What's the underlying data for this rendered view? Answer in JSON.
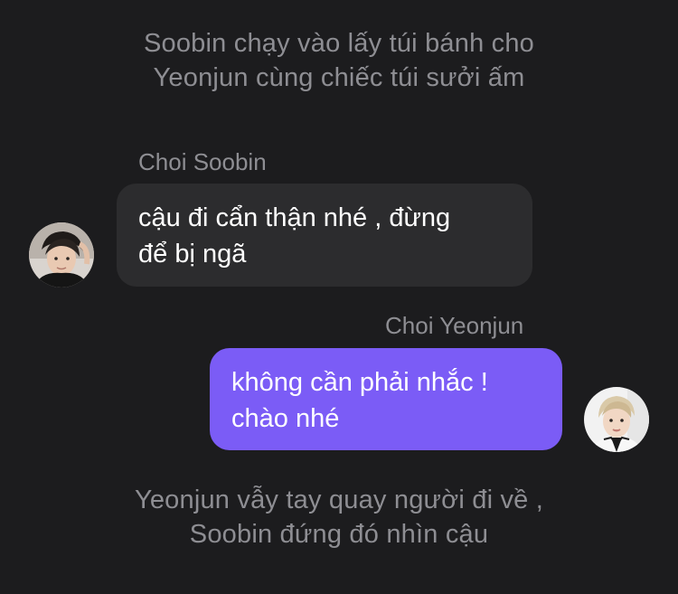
{
  "narration_top": {
    "line1": "Soobin chạy vào lấy túi bánh cho",
    "line2": "Yeonjun cùng chiếc túi sưởi ấm"
  },
  "messages": [
    {
      "sender": "Choi Soobin",
      "lines": [
        "cậu đi cẩn thận nhé , đừng",
        "để bị ngã"
      ],
      "bubble_color": "#2c2c2e",
      "side": "left"
    },
    {
      "sender": "Choi Yeonjun",
      "lines": [
        "không cần phải nhắc !",
        "chào nhé"
      ],
      "bubble_color": "#7b5cf6",
      "side": "right"
    }
  ],
  "narration_bottom": {
    "line1": "Yeonjun vẫy tay quay người đi về ,",
    "line2": "Soobin đứng đó nhìn cậu"
  },
  "colors": {
    "background": "#1c1c1e",
    "muted_text": "#8e8e93",
    "accent": "#7b5cf6"
  }
}
